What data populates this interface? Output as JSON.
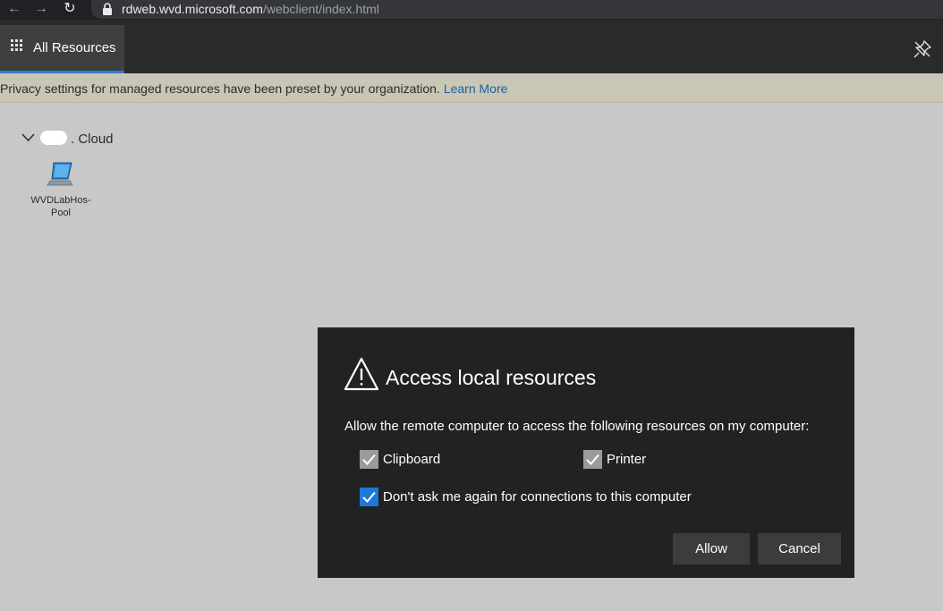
{
  "browser": {
    "url_host": "rdweb.wvd.microsoft.com",
    "url_path": "/webclient/index.html",
    "back_glyph": "←",
    "forward_glyph": "→",
    "reload_glyph": "↻"
  },
  "appbar": {
    "tab_label": "All Resources",
    "accent_color": "#2e7bcf"
  },
  "banner": {
    "text": "Privacy settings for managed resources have been preset by your organization.",
    "link": "Learn More"
  },
  "workspace": {
    "folder_label": ". Cloud",
    "resources": [
      {
        "label": "WVDLabHos-Pool",
        "icon": "pc-icon"
      }
    ]
  },
  "dialog": {
    "title": "Access local resources",
    "description": "Allow the remote computer to access the following resources on my computer:",
    "options": {
      "clipboard": {
        "label": "Clipboard",
        "checked": true
      },
      "printer": {
        "label": "Printer",
        "checked": true
      },
      "dont_ask": {
        "label": "Don't ask me again for connections to this computer",
        "checked": true
      }
    },
    "allow_label": "Allow",
    "cancel_label": "Cancel"
  }
}
